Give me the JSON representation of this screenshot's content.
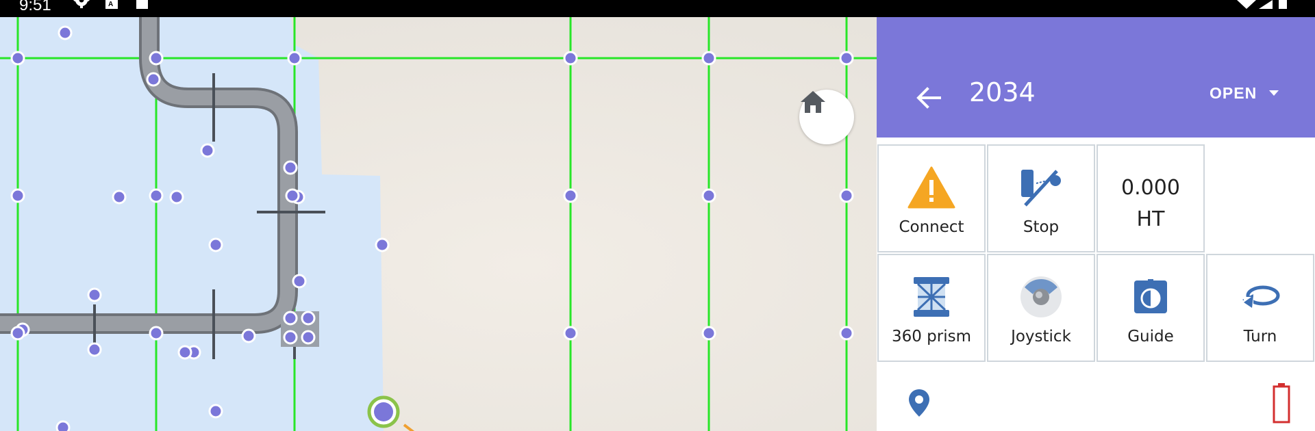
{
  "status_bar": {
    "time": "9:51",
    "left_icons": [
      "gear-icon",
      "text-app-icon",
      "square-icon"
    ],
    "right_icons": [
      "wifi-icon",
      "signal-icon",
      "battery-icon"
    ]
  },
  "map": {
    "home_icon": "home-icon",
    "colors": {
      "water": "#d5e6f9",
      "land": "#ede8e1",
      "grid_lines": "#28e628",
      "points": "#7b77d9",
      "road": "#8a8e95",
      "current_position_ring": "#8bc34a",
      "heading_line": "#f0a030"
    }
  },
  "header": {
    "back_icon": "arrow-left-icon",
    "title": "2034",
    "status": "OPEN",
    "dropdown_icon": "caret-down-icon",
    "background": "#7b77d9"
  },
  "tiles": [
    {
      "id": "connect",
      "label": "Connect",
      "icon": "warning-triangle-icon"
    },
    {
      "id": "stop",
      "label": "Stop",
      "icon": "stop-instrument-icon"
    },
    {
      "id": "ht",
      "value": "0.000",
      "unit": "HT"
    },
    {
      "id": "prism",
      "label": "360 prism",
      "icon": "prism-360-icon"
    },
    {
      "id": "joystick",
      "label": "Joystick",
      "icon": "joystick-icon"
    },
    {
      "id": "guide",
      "label": "Guide",
      "icon": "guide-icon"
    },
    {
      "id": "turn",
      "label": "Turn",
      "icon": "turn-icon"
    }
  ],
  "bottom_bar": {
    "left_icon": "location-pin-icon",
    "right_icon": "battery-empty-icon",
    "battery_color": "#d32f2f"
  }
}
